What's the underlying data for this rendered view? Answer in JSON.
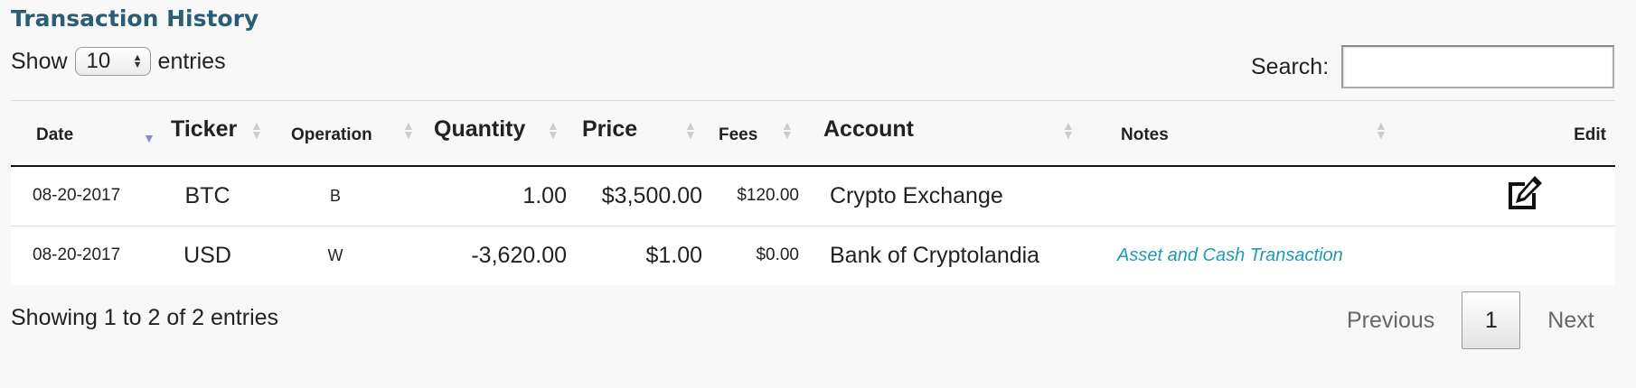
{
  "title": "Transaction History",
  "length_menu": {
    "prefix": "Show",
    "value": "10",
    "suffix": "entries"
  },
  "search": {
    "label": "Search:",
    "value": ""
  },
  "columns": {
    "date": "Date",
    "ticker": "Ticker",
    "operation": "Operation",
    "quantity": "Quantity",
    "price": "Price",
    "fees": "Fees",
    "account": "Account",
    "notes": "Notes",
    "edit": "Edit"
  },
  "sort": {
    "column": "date",
    "direction": "descending"
  },
  "rows": [
    {
      "date": "08-20-2017",
      "ticker": "BTC",
      "operation": "B",
      "quantity": "1.00",
      "price": "$3,500.00",
      "fees": "$120.00",
      "account": "Crypto Exchange",
      "notes": "",
      "editable": true
    },
    {
      "date": "08-20-2017",
      "ticker": "USD",
      "operation": "W",
      "quantity": "-3,620.00",
      "price": "$1.00",
      "fees": "$0.00",
      "account": "Bank of Cryptolandia",
      "notes": "Asset and Cash Transaction",
      "editable": false
    }
  ],
  "info": "Showing 1 to 2 of 2 entries",
  "pagination": {
    "previous": "Previous",
    "current": "1",
    "next": "Next"
  },
  "icons": {
    "edit": "edit-icon",
    "sort": "sort-both-icon",
    "sort_active": "sort-desc-icon",
    "select": "updown-icon"
  },
  "colors": {
    "title": "#2a5e74",
    "notes_link": "#1e9bb3",
    "active_sort": "#8b8be0"
  }
}
